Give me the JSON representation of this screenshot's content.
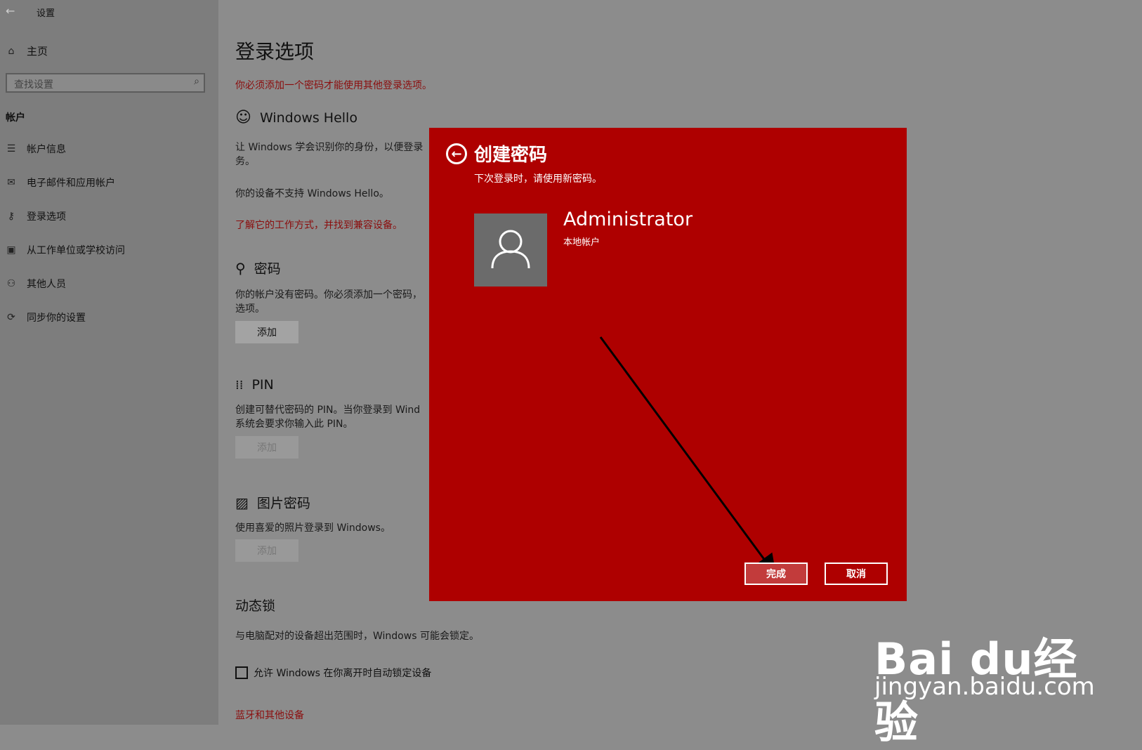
{
  "titlebar": {
    "title": "设置",
    "back_icon": "back-arrow-icon"
  },
  "sidebar": {
    "home_label": "主页",
    "search_placeholder": "查找设置",
    "section_header": "帐户",
    "items": [
      {
        "label": "帐户信息",
        "icon": "account-info-icon"
      },
      {
        "label": "电子邮件和应用帐户",
        "icon": "mail-icon"
      },
      {
        "label": "登录选项",
        "icon": "key-icon"
      },
      {
        "label": "从工作单位或学校访问",
        "icon": "briefcase-icon"
      },
      {
        "label": "其他人员",
        "icon": "person-add-icon"
      },
      {
        "label": "同步你的设置",
        "icon": "sync-icon"
      }
    ]
  },
  "main": {
    "title": "登录选项",
    "warning": "你必须添加一个密码才能使用其他登录选项。",
    "hello": {
      "heading": "Windows Hello",
      "desc": "让 Windows 学会识别你的身份，以便登录务。",
      "unsupported": "你的设备不支持 Windows Hello。",
      "link": "了解它的工作方式，并找到兼容设备。"
    },
    "password": {
      "heading": "密码",
      "desc": "你的帐户没有密码。你必须添加一个密码，选项。",
      "button": "添加"
    },
    "pin": {
      "heading": "PIN",
      "desc": "创建可替代密码的 PIN。当你登录到 Wind系统会要求你输入此 PIN。",
      "button": "添加"
    },
    "picture": {
      "heading": "图片密码",
      "desc": "使用喜爱的照片登录到 Windows。",
      "button": "添加"
    },
    "dynamic_lock": {
      "heading": "动态锁",
      "desc": "与电脑配对的设备超出范围时，Windows 可能会锁定。",
      "checkbox_label": "允许 Windows 在你离开时自动锁定设备"
    },
    "bottom_link": "蓝牙和其他设备"
  },
  "dialog": {
    "title": "创建密码",
    "subtitle": "下次登录时，请使用新密码。",
    "user_name": "Administrator",
    "user_type": "本地帐户",
    "finish_button": "完成",
    "cancel_button": "取消",
    "bg_color": "#ae0000"
  },
  "watermark": {
    "brand": "Bai du经验",
    "url": "jingyan.baidu.com"
  }
}
